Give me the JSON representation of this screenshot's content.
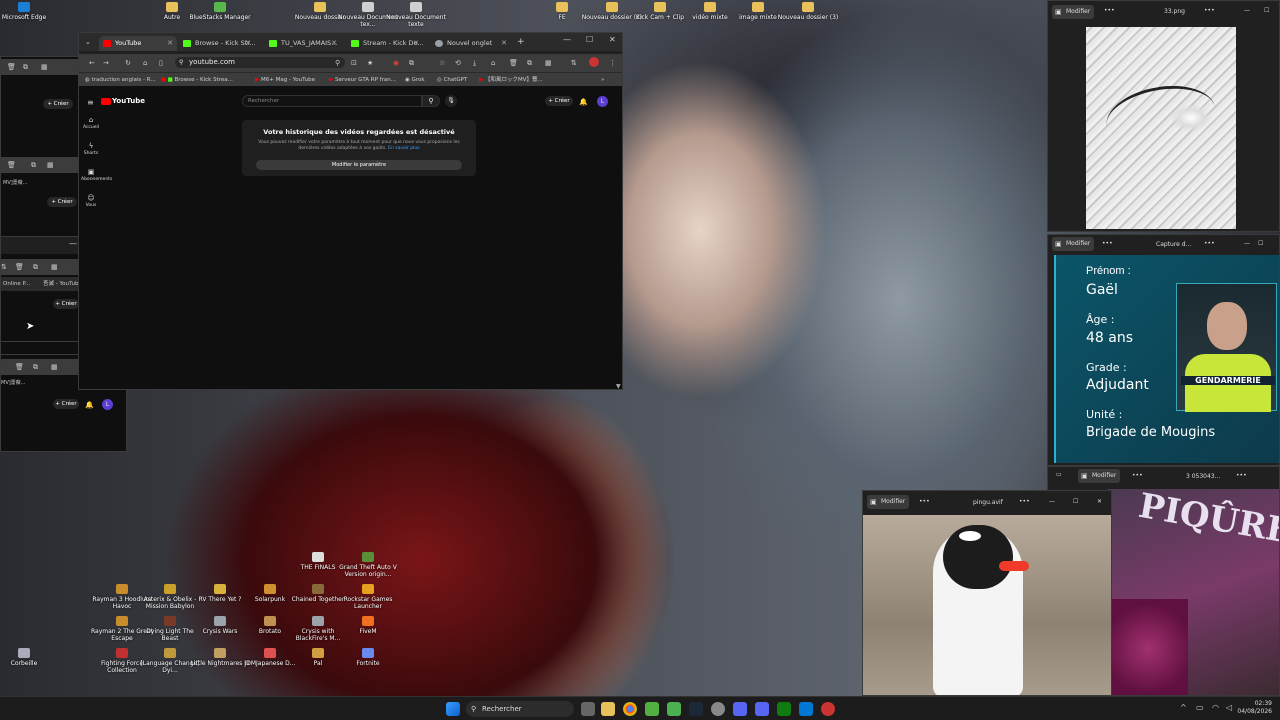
{
  "desktop": {
    "top_icons": [
      {
        "label": "Microsoft Edge",
        "color": "#1b7fd6"
      },
      {
        "label": "Autre",
        "color": "#e8c15b"
      },
      {
        "label": "BlueStacks Manager",
        "color": "#57b84b"
      },
      {
        "label": "Nouveau dossier",
        "color": "#e8c15b"
      },
      {
        "label": "Nouveau Document tex...",
        "color": "#cfcfcf"
      },
      {
        "label": "Nouveau Document texte",
        "color": "#cfcfcf"
      },
      {
        "label": "FE",
        "color": "#e8c15b"
      },
      {
        "label": "Nouveau dossier (2)",
        "color": "#e8c15b"
      },
      {
        "label": "Kick Cam + Clip",
        "color": "#e8c15b"
      },
      {
        "label": "vidéo mixte",
        "color": "#e8c15b"
      },
      {
        "label": "image mixte",
        "color": "#e8c15b"
      },
      {
        "label": "Nouveau dossier (3)",
        "color": "#e8c15b"
      }
    ],
    "game_icons": [
      {
        "label": "THE FINALS",
        "color": "#ddd"
      },
      {
        "label": "Grand Theft Auto V Version origin...",
        "color": "#5a8f3a"
      },
      {
        "label": "Rayman 3 Hoodlum Havoc",
        "color": "#c98c2a"
      },
      {
        "label": "Asterix & Obelix - Mission Babylon",
        "color": "#c9a02a"
      },
      {
        "label": "RV There Yet ?",
        "color": "#d8b23a"
      },
      {
        "label": "Solarpunk",
        "color": "#d09030"
      },
      {
        "label": "Chained Together",
        "color": "#8a6a3a"
      },
      {
        "label": "Rockstar Games Launcher",
        "color": "#e8a020"
      },
      {
        "label": "Rayman 2 The Great Escape",
        "color": "#c98c2a"
      },
      {
        "label": "Dying Light The Beast",
        "color": "#7a3a2a"
      },
      {
        "label": "Crysis Wars",
        "color": "#9aa4aa"
      },
      {
        "label": "Brotato",
        "color": "#c09050"
      },
      {
        "label": "Crysis with BlackFire's M...",
        "color": "#9aa4aa"
      },
      {
        "label": "FiveM",
        "color": "#f07020"
      },
      {
        "label": "Corbeille",
        "color": "#aab"
      },
      {
        "label": "Fighting Force Collection",
        "color": "#c03030"
      },
      {
        "label": "[Language Change] Dyi...",
        "color": "#c09a3a"
      },
      {
        "label": "Little Nightmares III",
        "color": "#c0a060"
      },
      {
        "label": "JDMJapanese D...",
        "color": "#e05050"
      },
      {
        "label": "Pal",
        "color": "#d0a040"
      },
      {
        "label": "Fortnite",
        "color": "#6a8af0"
      }
    ]
  },
  "browser": {
    "tabs": [
      {
        "label": "YouTube",
        "color": "#ff0000"
      },
      {
        "label": "Browse - Kick Str...",
        "color": "#53fc18"
      },
      {
        "label": "TU_VAS_JAMAIS...",
        "color": "#53fc18"
      },
      {
        "label": "Stream - Kick Do...",
        "color": "#53fc18"
      },
      {
        "label": "Nouvel onglet",
        "color": "#9aa0a6"
      }
    ],
    "new_tab": "+",
    "url": "youtube.com",
    "bookmarks": [
      "traduction anglais - R...",
      "Browse - Kick Strea...",
      "M6+ Mag - YouTube",
      "Serveur GTA RP fran...",
      "Grok",
      "ChatGPT",
      "【和風ロックMV】薔..."
    ],
    "yt": {
      "logo": "YouTube",
      "search_placeholder": "Rechercher",
      "create_label": "Créer",
      "avatar": "L",
      "nav": [
        "Accueil",
        "Shorts",
        "Abonnements",
        "Vous"
      ],
      "history_title": "Votre historique des vidéos regardées est désactivé",
      "history_body": "Vous pouvez modifier votre paramètre à tout moment pour que nous vous proposions les dernières vidéos adaptées à vos goûts.",
      "learn_more": "En savoir plus",
      "settings_button": "Modifier le paramètre"
    }
  },
  "small_window_1": {
    "bookmark_a": "Online P...",
    "bookmark_b": "吾滅 - YouTube",
    "create_label": "Créer",
    "avatar": "L"
  },
  "left_stubs": {
    "create_label": "Créer",
    "mv_label": "MV]薔薇...",
    "avatar": "L"
  },
  "viewer_33": {
    "edit_label": "Modifier",
    "title": "33.png"
  },
  "viewer_capture": {
    "edit_label": "Modifier",
    "title": "Capture d...",
    "card": {
      "l1": "Prénom :",
      "v1": "Gaël",
      "l2": "Âge :",
      "v2": "48 ans",
      "l3": "Grade :",
      "v3": "Adjudant",
      "l4": "Unité :",
      "v4": "Brigade de Mougins",
      "vest": "GENDARMERIE"
    }
  },
  "viewer_3053": {
    "edit_label": "Modifier",
    "title": "3 053043..."
  },
  "viewer_pingu": {
    "edit_label": "Modifier",
    "title": "pingu.avif"
  },
  "poster_text": "PIQÛRE",
  "taskbar": {
    "search": "Rechercher",
    "time": "02:39",
    "date": "04/08/2026"
  },
  "colors": {
    "accent": "#3c3c3c",
    "youtube_red": "#ff0000",
    "kick_green": "#53fc18",
    "card_bg": "#0d4a5c"
  }
}
